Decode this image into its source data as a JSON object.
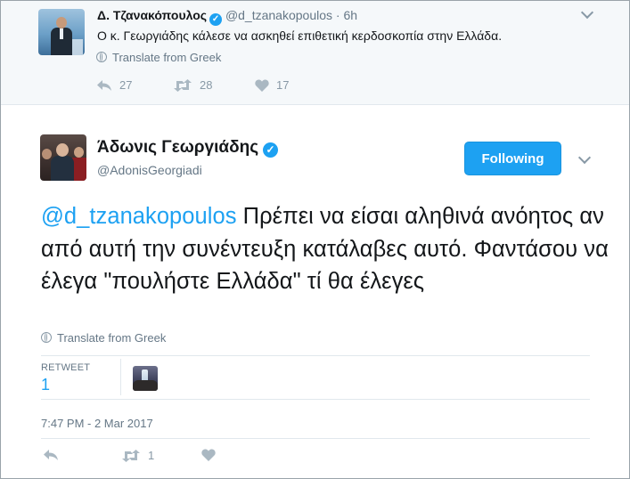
{
  "parent_tweet": {
    "name": "Δ. Τζανακόπουλος",
    "handle": "@d_tzanakopoulos",
    "separator": "·",
    "time": "6h",
    "text": "Ο κ. Γεωργιάδης κάλεσε να ασκηθεί επιθετική κερδοσκοπία στην Ελλάδα.",
    "translate_label": "Translate from Greek",
    "replies": "27",
    "retweets": "28",
    "likes": "17"
  },
  "main_tweet": {
    "name": "Άδωνις Γεωργιάδης",
    "handle": "@AdonisGeorgiadi",
    "follow_button": "Following",
    "mention": "@d_tzanakopoulos",
    "text": " Πρέπει να είσαι αληθινά ανόητος αν από αυτή την συνέντευξη κατάλαβες αυτό. Φαντάσου να έλεγα \"πουλήστε Ελλάδα\" τί θα έλεγες",
    "translate_label": "Translate from Greek",
    "retweet_label": "RETWEET",
    "retweet_count": "1",
    "timestamp": "7:47 PM - 2 Mar 2017",
    "action_retweets": "1"
  },
  "icons": {
    "verified": "verified-badge-icon",
    "reply": "reply-icon",
    "retweet": "retweet-icon",
    "like": "heart-icon",
    "translate": "globe-icon",
    "menu": "chevron-down-icon"
  },
  "colors": {
    "accent": "#1da1f2",
    "muted": "#657786",
    "parent_background": "#f5f8fa"
  }
}
